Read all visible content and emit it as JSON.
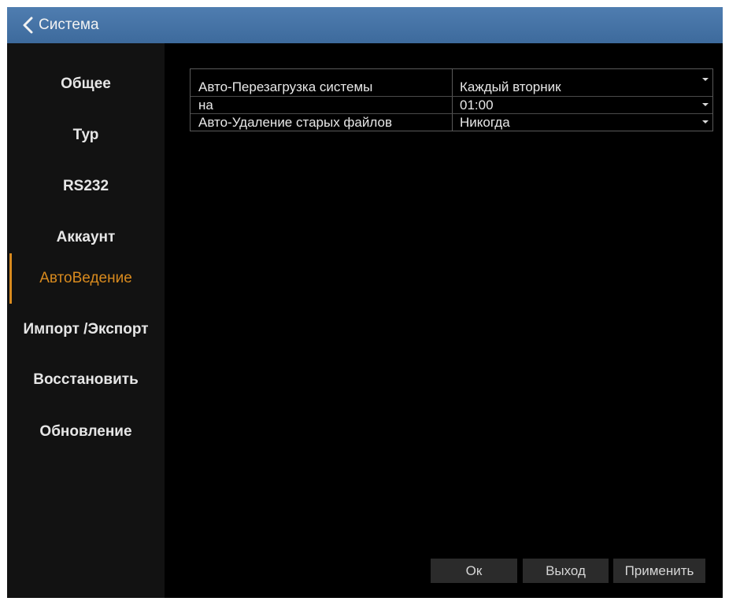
{
  "title_bar": {
    "title": "Система",
    "back_icon": "chevron-left-icon",
    "background": "#4a78aa"
  },
  "sidebar": {
    "items": [
      {
        "label": "Общее",
        "active": false
      },
      {
        "label": "Тур",
        "active": false
      },
      {
        "label": "RS232",
        "active": false
      },
      {
        "label": "Аккаунт",
        "active": false
      },
      {
        "label": "АвтоВедение",
        "active": true
      },
      {
        "label": "Импорт /Экспорт",
        "active": false
      },
      {
        "label": "Восстановить",
        "active": false
      },
      {
        "label": "Обновление",
        "active": false
      }
    ],
    "active_color": "#d88a1e"
  },
  "settings": {
    "rows": [
      {
        "label": "Авто-Перезагрузка системы",
        "value": "Каждый вторник"
      },
      {
        "label": "на",
        "value": "01:00"
      },
      {
        "label": "Авто-Удаление старых файлов",
        "value": "Никогда"
      }
    ]
  },
  "buttons": {
    "ok": "Ок",
    "exit": "Выход",
    "apply": "Применить"
  }
}
